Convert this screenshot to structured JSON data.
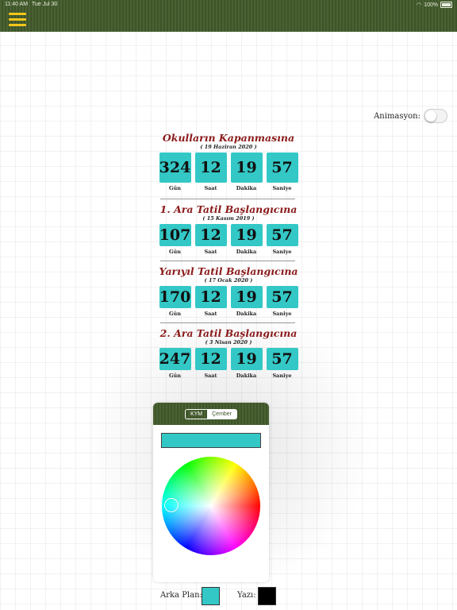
{
  "status": {
    "time": "11:40 AM",
    "date": "Tue Jul 30",
    "battery": "100%"
  },
  "icons": {
    "menu": "hamburger-menu-icon",
    "wifi": "wifi-icon",
    "battery": "battery-icon"
  },
  "animation": {
    "label": "Animasyon:",
    "enabled": false
  },
  "countdowns": [
    {
      "title": "Okulların Kapanmasına",
      "date": "( 19 Haziran 2020 )",
      "days": "324",
      "hours": "12",
      "minutes": "19",
      "seconds": "57"
    },
    {
      "title": "1. Ara Tatil Başlangıcına",
      "date": "( 15 Kasım 2019 )",
      "days": "107",
      "hours": "12",
      "minutes": "19",
      "seconds": "57"
    },
    {
      "title": "Yarıyıl Tatil Başlangıcına",
      "date": "( 17 Ocak 2020 )",
      "days": "170",
      "hours": "12",
      "minutes": "19",
      "seconds": "57"
    },
    {
      "title": "2. Ara Tatil Başlangıcına",
      "date": "( 3 Nisan 2020 )",
      "days": "247",
      "hours": "12",
      "minutes": "19",
      "seconds": "57"
    }
  ],
  "units": {
    "days": "Gün",
    "hours": "Saat",
    "minutes": "Dakika",
    "seconds": "Saniye"
  },
  "picker": {
    "modes": [
      "KYM",
      "Çember"
    ],
    "active_mode": "Çember",
    "selected_color": "#33c8c6"
  },
  "swatches": {
    "background_label": "Arka Plan:",
    "background_color": "#33c8c6",
    "text_label": "Yazı:",
    "text_color": "#000000"
  },
  "colors": {
    "accent_green": "#4a6233",
    "title_red": "#8b1a1a",
    "menu_yellow": "#f3c61a"
  }
}
